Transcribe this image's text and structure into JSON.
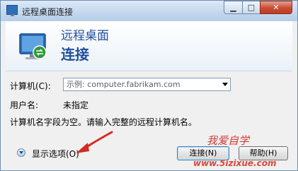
{
  "window": {
    "title": "远程桌面连接",
    "controls": {
      "minimize": "▁",
      "maximize": "□",
      "close": "✕"
    }
  },
  "header": {
    "line1": "远程桌面",
    "line2": "连接",
    "icon": "remote-desktop-icon"
  },
  "form": {
    "computer_label": "计算机(C):",
    "computer_placeholder": "示例: computer.fabrikam.com",
    "username_label": "用户名:",
    "username_value": "未指定",
    "error_message": "计算机名字段为空。请输入完整的远程计算机名。"
  },
  "footer": {
    "show_options": "显示选项(O)",
    "connect_button": "连接(N)",
    "help_button": "帮助(H)"
  },
  "watermark": {
    "line1": "我爱自学",
    "line2": "www.5izixue.com"
  },
  "colors": {
    "header_text": "#1f4f9b",
    "annotation_arrow": "#d42b22",
    "watermark": "#cf3b36"
  }
}
